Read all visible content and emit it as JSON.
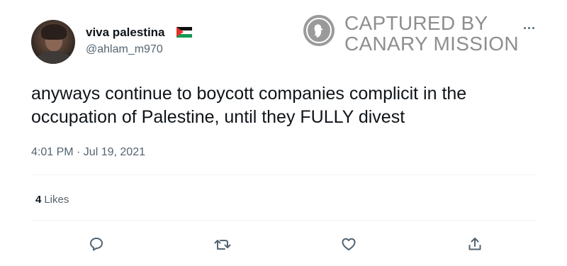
{
  "user": {
    "display_name": "viva palestina",
    "handle": "@ahlam_m970",
    "flag_icon": "palestine-flag-icon"
  },
  "watermark": {
    "line1": "CAPTURED BY",
    "line2": "CANARY MISSION"
  },
  "tweet": {
    "text": "anyways continue to boycott companies complicit in the occupation of Palestine, until they FULLY divest",
    "timestamp": "4:01 PM · Jul 19, 2021"
  },
  "stats": {
    "likes_count": "4",
    "likes_label": "Likes"
  },
  "more_label": "···",
  "actions": [
    "reply-icon",
    "retweet-icon",
    "like-icon",
    "share-icon"
  ],
  "colors": {
    "text": "#0f1419",
    "secondary": "#536471",
    "divider": "#eff3f4",
    "watermark": "#8e8e8e"
  }
}
